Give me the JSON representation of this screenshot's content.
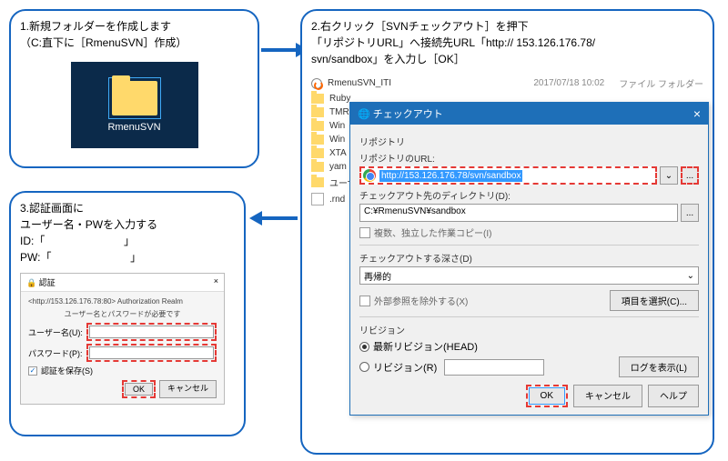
{
  "step1": {
    "title": "1.新規フォルダーを作成します",
    "sub": "（C:直下に［RmenuSVN］作成）",
    "folder_name": "RmenuSVN"
  },
  "step2": {
    "title": "2.右クリック［SVNチェックアウト］を押下",
    "line2": "「リポジトリURL」へ接続先URL「http:// 153.126.176.78/",
    "line3": "svn/sandbox」を入力し［OK］"
  },
  "step3": {
    "title": "3.認証画面に",
    "line2": "ユーザー名・PWを入力する",
    "id_label": "ID:「",
    "id_end": "」",
    "pw_label": "PW:「",
    "pw_end": "」"
  },
  "explorer": {
    "rows": [
      {
        "name": "RmenuSVN_ITI",
        "date": "2017/07/18 10:02",
        "type": "ファイル フォルダー",
        "icon": "svn"
      },
      {
        "name": "Ruby"
      },
      {
        "name": "TMR"
      },
      {
        "name": "Win"
      },
      {
        "name": "Win"
      },
      {
        "name": "XTA"
      },
      {
        "name": "yam"
      },
      {
        "name": "ユーザ"
      },
      {
        "name": ".rnd",
        "icon": "file"
      }
    ]
  },
  "checkout": {
    "title": "チェックアウト",
    "close": "×",
    "repo_group": "リポジトリ",
    "url_label": "リポジトリのURL:",
    "url_value": "http://153.126.176.78/svn/sandbox",
    "dir_label": "チェックアウト先のディレクトリ(D):",
    "dir_value": "C:¥RmenuSVN¥sandbox",
    "multi_check": "複数、独立した作業コピー(I)",
    "depth_label": "チェックアウトする深さ(D)",
    "depth_value": "再帰的",
    "externals": "外部参照を除外する(X)",
    "select_items": "項目を選択(C)...",
    "rev_group": "リビジョン",
    "head": "最新リビジョン(HEAD)",
    "rev": "リビジョン(R)",
    "showlog": "ログを表示(L)",
    "ok": "OK",
    "cancel": "キャンセル",
    "help": "ヘルプ",
    "dots": "...",
    "dd": "⌄"
  },
  "auth": {
    "title": "認証",
    "realm": "<http://153.126.176.78:80> Authorization Realm",
    "prompt": "ユーザー名とパスワードが必要です",
    "user_label": "ユーザー名(U):",
    "pass_label": "パスワード(P):",
    "save": "認証を保存(S)",
    "ok": "OK",
    "cancel": "キャンセル",
    "check": "✓",
    "lock": "🔒"
  }
}
